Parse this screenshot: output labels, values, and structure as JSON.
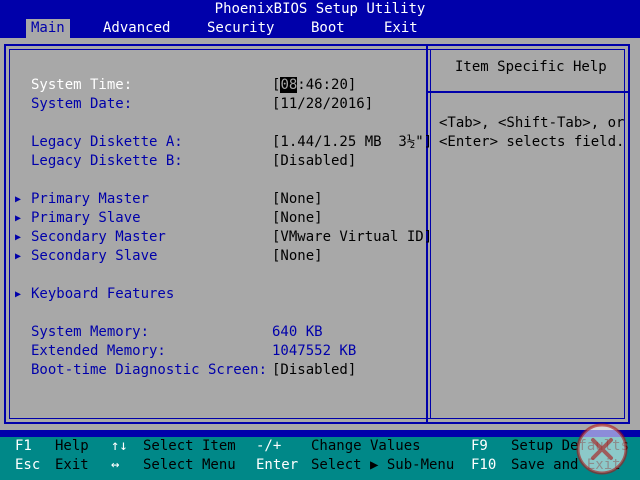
{
  "title": "PhoenixBIOS Setup Utility",
  "menu": [
    {
      "label": "Main",
      "active": true
    },
    {
      "label": "Advanced",
      "active": false
    },
    {
      "label": "Security",
      "active": false
    },
    {
      "label": "Boot",
      "active": false
    },
    {
      "label": "Exit",
      "active": false
    }
  ],
  "settings": {
    "system_time": {
      "label": "System Time:",
      "value_open": "[",
      "value_cursor": "08",
      "value_rest": ":46:20]"
    },
    "system_date": {
      "label": "System Date:",
      "value": "[11/28/2016]"
    },
    "legacy_a": {
      "label": "Legacy Diskette A:",
      "value": "[1.44/1.25 MB  3½\"]"
    },
    "legacy_b": {
      "label": "Legacy Diskette B:",
      "value": "[Disabled]"
    },
    "primary_master": {
      "label": "Primary Master",
      "value": "[None]"
    },
    "primary_slave": {
      "label": "Primary Slave",
      "value": "[None]"
    },
    "secondary_master": {
      "label": "Secondary Master",
      "value": "[VMware Virtual ID]"
    },
    "secondary_slave": {
      "label": "Secondary Slave",
      "value": "[None]"
    },
    "keyboard_features": {
      "label": "Keyboard Features"
    },
    "system_memory": {
      "label": "System Memory:",
      "value": "640 KB"
    },
    "extended_memory": {
      "label": "Extended Memory:",
      "value": "1047552 KB"
    },
    "boot_diag": {
      "label": "Boot-time Diagnostic Screen:",
      "value": "[Disabled]"
    }
  },
  "help": {
    "title": "Item Specific Help",
    "line1": "<Tab>, <Shift-Tab>, or",
    "line2": "<Enter> selects field."
  },
  "status": {
    "f1_key": "F1",
    "f1_desc": "Help",
    "updown_key": "↑↓",
    "updown_desc": "Select Item",
    "minusplus_key": "-/+",
    "minusplus_desc": "Change Values",
    "f9_key": "F9",
    "f9_desc": "Setup Defaults",
    "esc_key": "Esc",
    "esc_desc": "Exit",
    "leftright_key": "↔",
    "leftright_desc": "Select Menu",
    "enter_key": "Enter",
    "enter_desc": "Select ▶ Sub-Menu",
    "f10_key": "F10",
    "f10_desc": "Save and Exit"
  },
  "colors": {
    "background_blue": "#0000aa",
    "panel_gray": "#a8a8a8",
    "status_teal": "#008888",
    "text_white": "#ffffff",
    "text_black": "#000000"
  },
  "icons": {
    "submenu_arrow": "submenu-arrow-icon",
    "watermark": "site-logo-watermark-icon"
  }
}
